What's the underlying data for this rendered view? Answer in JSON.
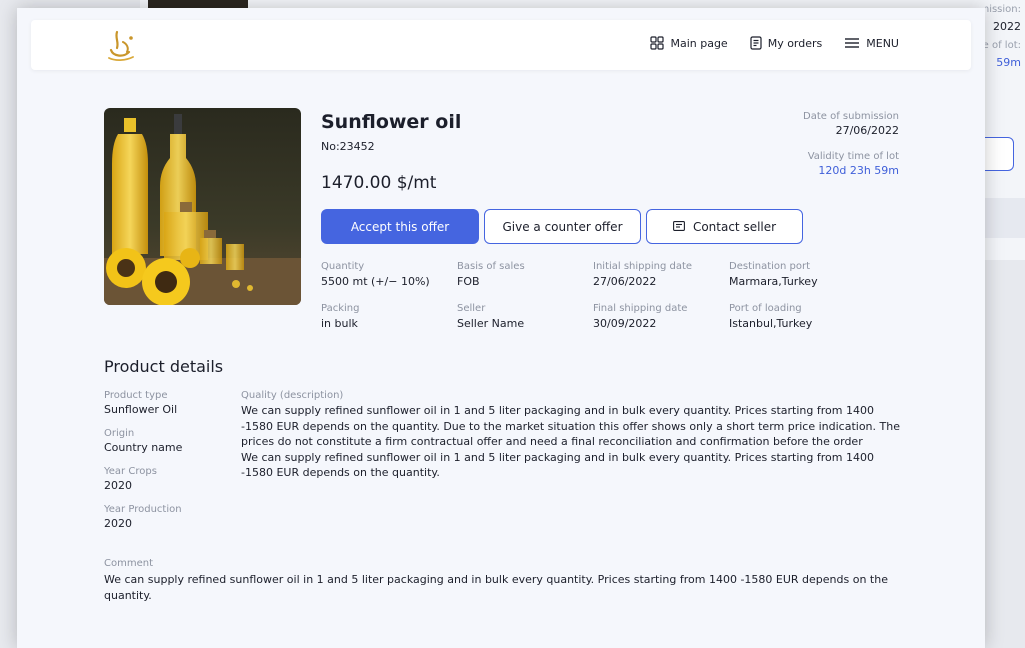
{
  "background": {
    "submission_label": "Date of submission:",
    "year": "2022",
    "lot_label": "Validity time of lot:",
    "lot_value": "59m"
  },
  "nav": {
    "main_page": "Main page",
    "my_orders": "My orders",
    "menu": "MENU"
  },
  "product": {
    "title": "Sunflower oil",
    "number": "No:23452",
    "price": "1470.00 $/mt"
  },
  "meta": {
    "date_label": "Date of submission",
    "date_value": "27/06/2022",
    "validity_label": "Validity time of lot",
    "validity_value": "120d 23h 59m"
  },
  "actions": {
    "accept": "Accept this offer",
    "counter": "Give a counter offer",
    "contact": "Contact seller"
  },
  "specs": {
    "quantity_label": "Quantity",
    "quantity_value": "5500 mt (+/− 10%)",
    "basis_label": "Basis of sales",
    "basis_value": "FOB",
    "initial_label": "Initial shipping date",
    "initial_value": "27/06/2022",
    "dest_label": "Destination port",
    "dest_value": "Marmara,Turkey",
    "packing_label": "Packing",
    "packing_value": "in bulk",
    "seller_label": "Seller",
    "seller_value": "Seller Name",
    "final_label": "Final shipping date",
    "final_value": "30/09/2022",
    "loading_label": "Port of loading",
    "loading_value": "Istanbul,Turkey"
  },
  "details": {
    "title": "Product details",
    "type_label": "Product type",
    "type_value": "Sunflower Oil",
    "origin_label": "Origin",
    "origin_value": "Country name",
    "crops_label": "Year Crops",
    "crops_value": "2020",
    "production_label": "Year Production",
    "production_value": "2020",
    "quality_label": "Quality (description)",
    "quality_text_1": "We can supply refined sunflower oil in 1 and 5 liter packaging and in bulk every quantity. Prices starting from 1400 -1580 EUR depends on the quantity. Due to the market situation this offer shows only a short term price indication. The prices do not constitute a firm contractual offer and need a final reconciliation and confirmation before the order",
    "quality_text_2": "We can supply refined sunflower oil in 1 and 5 liter packaging and in bulk every quantity. Prices starting from 1400 -1580 EUR depends on the quantity.",
    "comment_label": "Comment",
    "comment_text": "We can supply refined sunflower oil in 1 and 5 liter packaging and in bulk every quantity. Prices starting from 1400 -1580 EUR depends on the quantity."
  },
  "icons": {
    "logo": "logo-icon",
    "main_page": "grid-icon",
    "my_orders": "document-icon",
    "menu": "hamburger-icon",
    "contact": "message-icon"
  },
  "colors": {
    "accent": "#4565e0",
    "muted": "#8d93a1",
    "page_bg": "#f5f7fc"
  }
}
